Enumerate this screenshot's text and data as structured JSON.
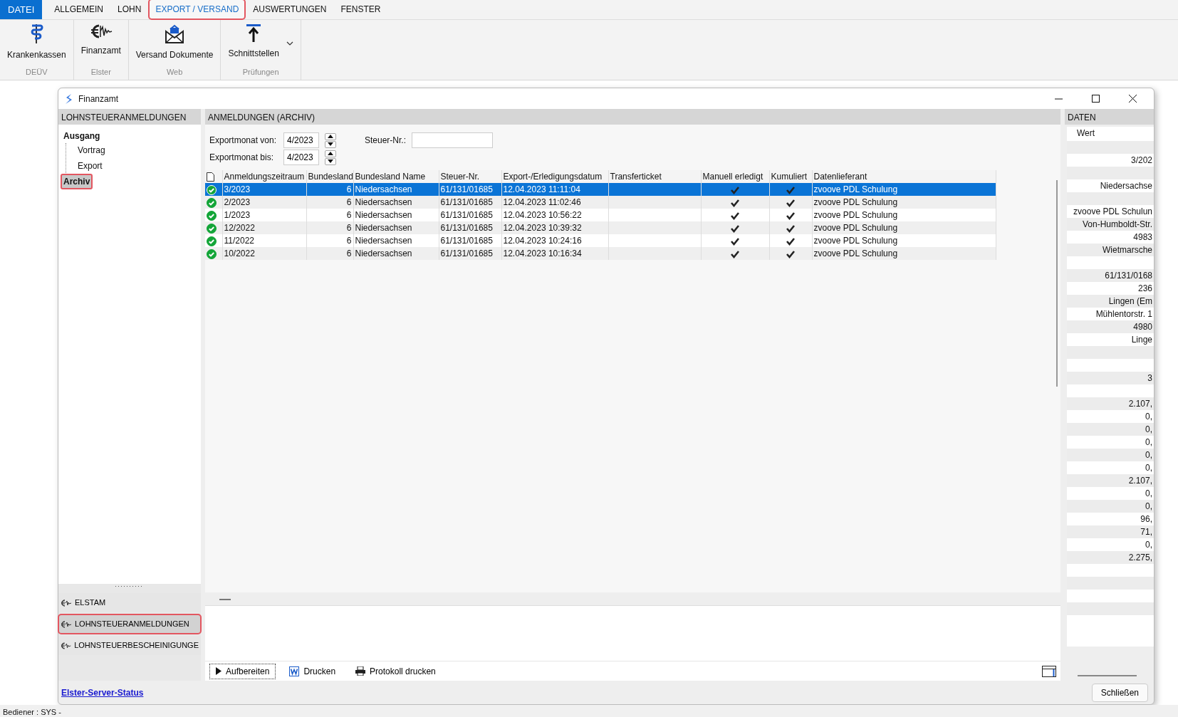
{
  "menu_tabs": [
    {
      "label": "DATEI",
      "kind": "file",
      "selected": false,
      "highlighted": false
    },
    {
      "label": "ALLGEMEIN",
      "kind": "tab",
      "selected": false,
      "highlighted": false
    },
    {
      "label": "LOHN",
      "kind": "tab",
      "selected": false,
      "highlighted": false
    },
    {
      "label": "EXPORT / VERSAND",
      "kind": "tab",
      "selected": true,
      "highlighted": true
    },
    {
      "label": "AUSWERTUNGEN",
      "kind": "tab",
      "selected": false,
      "highlighted": false
    },
    {
      "label": "FENSTER",
      "kind": "tab",
      "selected": false,
      "highlighted": false
    }
  ],
  "ribbon": {
    "groups": [
      {
        "label": "DEÜV",
        "buttons": [
          {
            "label": "Krankenkassen",
            "kind": "caduceus",
            "dropdown": false
          }
        ]
      },
      {
        "label": "Elster",
        "buttons": [
          {
            "label": "Finanzamt",
            "kind": "euro",
            "dropdown": false
          }
        ]
      },
      {
        "label": "Web",
        "buttons": [
          {
            "label": "Versand Dokumente",
            "kind": "envelope",
            "dropdown": false
          }
        ]
      },
      {
        "label": "Prüfungen",
        "buttons": [
          {
            "label": "Schnittstellen",
            "kind": "upload",
            "dropdown": true
          }
        ]
      }
    ]
  },
  "window": {
    "title": "Finanzamt"
  },
  "left_panel": {
    "title": "LOHNSTEUERANMELDUNGEN",
    "tree": [
      {
        "label": "Ausgang",
        "selected": false,
        "highlighted": false,
        "children": [
          {
            "label": "Vortrag",
            "selected": false,
            "highlighted": false
          },
          {
            "label": "Export",
            "selected": false,
            "highlighted": false
          }
        ]
      },
      {
        "label": "Archiv",
        "selected": true,
        "highlighted": true
      }
    ],
    "nav_items": [
      {
        "label": "ELSTAM",
        "selected": false,
        "highlighted": false
      },
      {
        "label": "LOHNSTEUERANMELDUNGEN",
        "selected": true,
        "highlighted": true
      },
      {
        "label": "LOHNSTEUERBESCHEINIGUNGE",
        "selected": false,
        "highlighted": false
      }
    ]
  },
  "main": {
    "title": "ANMELDUNGEN (ARCHIV)",
    "filters": [
      {
        "label": "Exportmonat von:",
        "value": "4/2023"
      },
      {
        "label": "Exportmonat bis:",
        "value": "4/2023"
      }
    ],
    "tax_field": {
      "label": "Steuer-Nr.:"
    },
    "table": {
      "columns": [
        "Anmeldungszeitraum",
        "Bundesland",
        "Bundesland Name",
        "Steuer-Nr.",
        "Export-/Erledigungsdatum",
        "Transferticket",
        "Manuell erledigt",
        "Kumuliert",
        "Datenlieferant"
      ],
      "rows": [
        {
          "selected": true,
          "done": true,
          "period": "3/2023",
          "state": "6",
          "state_name": "Niedersachsen",
          "tax_no": "61/131/01685",
          "date": "12.04.2023 11:11:04",
          "manual": true,
          "cumulated": true,
          "supplier": "zvoove PDL Schulung"
        },
        {
          "selected": false,
          "done": true,
          "period": "2/2023",
          "state": "6",
          "state_name": "Niedersachsen",
          "tax_no": "61/131/01685",
          "date": "12.04.2023 11:02:46",
          "manual": true,
          "cumulated": true,
          "supplier": "zvoove PDL Schulung"
        },
        {
          "selected": false,
          "done": true,
          "period": "1/2023",
          "state": "6",
          "state_name": "Niedersachsen",
          "tax_no": "61/131/01685",
          "date": "12.04.2023 10:56:22",
          "manual": true,
          "cumulated": true,
          "supplier": "zvoove PDL Schulung"
        },
        {
          "selected": false,
          "done": true,
          "period": "12/2022",
          "state": "6",
          "state_name": "Niedersachsen",
          "tax_no": "61/131/01685",
          "date": "12.04.2023 10:39:32",
          "manual": true,
          "cumulated": true,
          "supplier": "zvoove PDL Schulung"
        },
        {
          "selected": false,
          "done": true,
          "period": "11/2022",
          "state": "6",
          "state_name": "Niedersachsen",
          "tax_no": "61/131/01685",
          "date": "12.04.2023 10:24:16",
          "manual": true,
          "cumulated": true,
          "supplier": "zvoove PDL Schulung"
        },
        {
          "selected": false,
          "done": true,
          "period": "10/2022",
          "state": "6",
          "state_name": "Niedersachsen",
          "tax_no": "61/131/01685",
          "date": "12.04.2023 10:16:34",
          "manual": true,
          "cumulated": true,
          "supplier": "zvoove PDL Schulung"
        }
      ]
    },
    "actions": [
      {
        "label": "Aufbereiten",
        "kind": "play"
      },
      {
        "label": "Drucken",
        "kind": "word"
      },
      {
        "label": "Protokoll drucken",
        "kind": "printer"
      }
    ]
  },
  "right_panel": {
    "title": "DATEN",
    "column": "Wert",
    "rows": [
      {},
      {
        "value": "3/202"
      },
      {},
      {
        "value": "Niedersachse"
      },
      {},
      {
        "value": "zvoove PDL Schulun"
      },
      {
        "value": "Von-Humboldt-Str."
      },
      {
        "value": "4983"
      },
      {
        "value": "Wietmarsche"
      },
      {},
      {
        "value": "61/131/0168"
      },
      {
        "value": "236"
      },
      {
        "value": "Lingen (Em"
      },
      {
        "value": "Mühlentorstr. 1"
      },
      {
        "value": "4980"
      },
      {
        "value": "Linge"
      },
      {},
      {},
      {
        "value": "3"
      },
      {},
      {
        "value": "2.107,"
      },
      {
        "value": "0,"
      },
      {
        "value": "0,"
      },
      {
        "value": "0,"
      },
      {
        "value": "0,"
      },
      {
        "value": "0,"
      },
      {
        "value": "2.107,"
      },
      {
        "value": "0,"
      },
      {
        "value": "0,"
      },
      {
        "value": "96,"
      },
      {
        "value": "71,"
      },
      {
        "value": "0,"
      },
      {
        "value": "2.275,"
      },
      {},
      {},
      {},
      {},
      {}
    ]
  },
  "footer": {
    "link": "Elster-Server-Status",
    "close_button": "Schließen"
  },
  "status_bar": {
    "text": "Bediener : SYS -"
  }
}
